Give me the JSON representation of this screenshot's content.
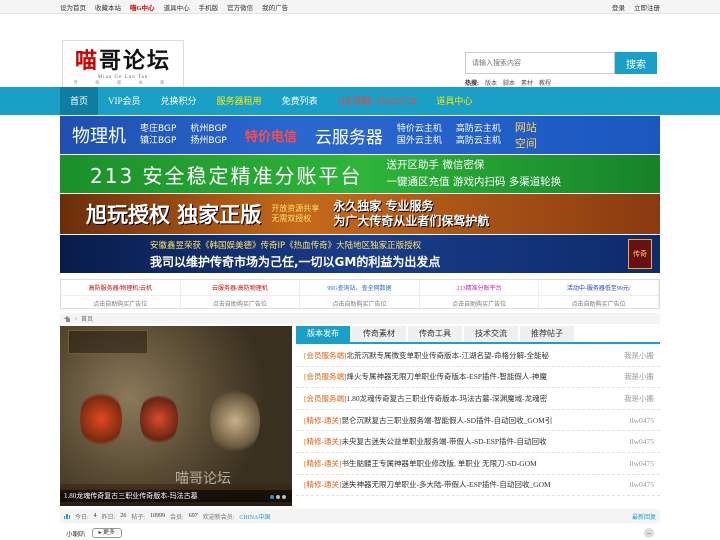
{
  "topbar": {
    "left": [
      "设为首页",
      "收藏本站",
      "喵G中心",
      "道具中心",
      "手机版",
      "官方微信",
      "我的广告"
    ],
    "right": [
      "登录",
      "立即注册"
    ]
  },
  "logo": {
    "mark_a": "喵",
    "mark_b": "哥论坛",
    "sub": "Miao Ge Lun Tan",
    "sub2": "传 奇 版 本 库"
  },
  "search": {
    "placeholder": "请输入搜索内容",
    "button": "搜索",
    "hot_label": "热搜:",
    "hot": [
      "版本",
      "脚本",
      "素材",
      "教程"
    ]
  },
  "nav": [
    "首页",
    "VIP会员",
    "兑换积分",
    "服务器租用",
    "免费列表",
    "Q交流群: 335222729",
    "道具中心"
  ],
  "banner1": {
    "big": "物理机",
    "col1": [
      "枣庄BGP",
      "镇江BGP"
    ],
    "col2": [
      "杭州BGP",
      "扬州BGP"
    ],
    "price": "特价电信",
    "big2": "云服务器",
    "col3": [
      "特价云主机",
      "国外云主机"
    ],
    "col4": [
      "高防云主机",
      "高防云主机"
    ],
    "side": [
      "网站",
      "空间"
    ]
  },
  "banner2": {
    "big": "213 安全稳定精准分账平台",
    "row1": "送开区助手    微信密保",
    "row2": "一键通区充值  游戏内扫码  多渠道轮换"
  },
  "banner3": {
    "big": "旭玩授权 独家正版",
    "mid": [
      "开放资源共享",
      "无需双授权"
    ],
    "right": [
      "永久独家  专业服务",
      "为广大传奇从业者们保驾护航"
    ]
  },
  "banner4": {
    "t1": "安徽鑫昱荣获《韩国娱美德》传奇IP《热血传奇》大陆地区独家正版授权",
    "t2": "我司以维护传奇市场为己任,一切以GM的利益为出发点",
    "badge": "传奇"
  },
  "adgrid": {
    "row1": [
      {
        "text": "高防服务器/物理机/云机",
        "color": "#d00000"
      },
      {
        "text": "云服务器/高防物理机",
        "color": "#d00000"
      },
      {
        "text": "99G查询站、查全网数据",
        "color": "#2a6ad0"
      },
      {
        "text": "213精准分账平台",
        "color": "#c020c0"
      },
      {
        "text": "活动中-服务器低至99元/",
        "color": "#1a40c0"
      }
    ],
    "row2": [
      "点击自助购买广告位",
      "点击自助购买广告位",
      "点击自助购买广告位",
      "点击自助购买广告位",
      "点击自助购买广告位"
    ]
  },
  "crumb": {
    "sep": "›",
    "page": "首页"
  },
  "slide": {
    "caption": "1.80龙魂传奇复古三职业传奇版本-玛法古墓",
    "watermark": "喵哥论坛"
  },
  "tabs": [
    "版本发布",
    "传奇素材",
    "传奇工具",
    "技术交流",
    "推荐帖子"
  ],
  "posts": [
    {
      "tag": "[会员服务端]",
      "title": "北荒沉默专属微变单职业传奇版本-江湖名望-命格分解-全能秘",
      "user": "我是小搬"
    },
    {
      "tag": "[会员服务端]",
      "title": "烽火专属神器无限刀单职业传奇版本-ESP插件-智能假人-神魔",
      "user": "我是小搬"
    },
    {
      "tag": "[会员服务端]",
      "title": "1.80龙魂传奇复古三职业传奇版本-玛法古墓-深渊魔域-龙魂密",
      "user": "我是小搬"
    },
    {
      "tag": "[精修-通关]",
      "title": "昆仑沉默复古三职业服务端-智能假人-SD插件-自动回收_GOM引",
      "user": "llw0475"
    },
    {
      "tag": "[精修-通关]",
      "title": "未央复古迷失公益单职业服务端-带假人-SD-ESP插件-自动回收",
      "user": "llw0475"
    },
    {
      "tag": "[精修-通关]",
      "title": "书生骷髅王专属神器单职业修改版, 单职业 无限刀-SD-GOM",
      "user": "llw0475"
    },
    {
      "tag": "[精修-通关]",
      "title": "迷失神器无限刀单职业-多大陆-带假人-ESP插件-自动回收_GOM",
      "user": "llw0475"
    }
  ],
  "stats": {
    "today_label": "今日:",
    "today": "4",
    "yesterday_label": "昨日:",
    "yesterday": "26",
    "posts_label": "帖子:",
    "posts": "10999",
    "members_label": "会员:",
    "members": "697",
    "welcome_label": "欢迎新会员:",
    "welcome": "CHINA中国",
    "latest": "最新回复"
  },
  "forum": {
    "name": "小喇叭",
    "more": "更多",
    "minus": "–"
  }
}
